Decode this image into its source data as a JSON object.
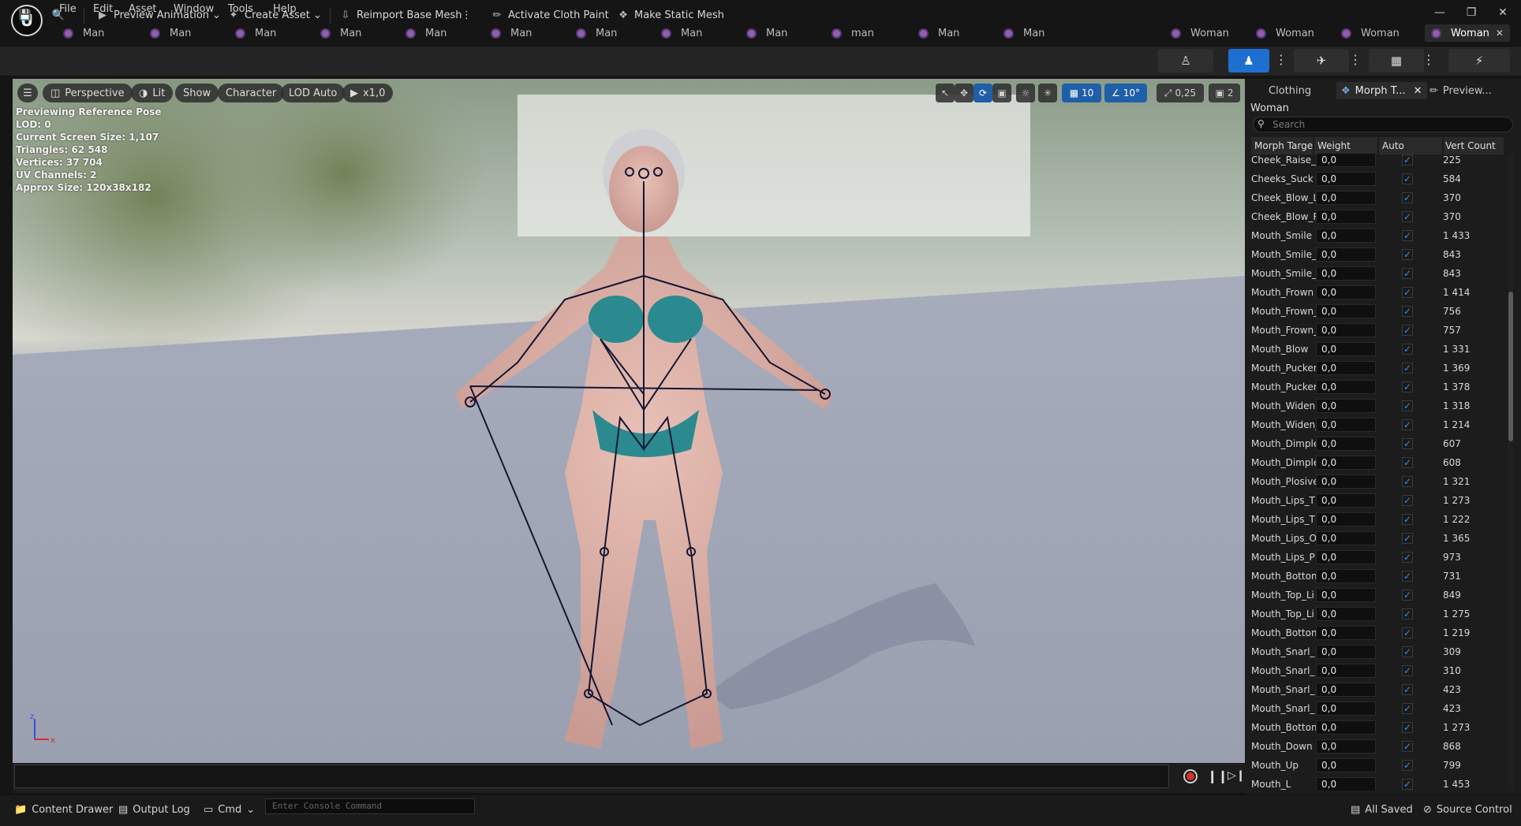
{
  "menu": [
    "File",
    "Edit",
    "Asset",
    "Window",
    "Tools",
    "Help"
  ],
  "tabs": [
    {
      "label": "Man"
    },
    {
      "label": "Man"
    },
    {
      "label": "Man"
    },
    {
      "label": "Man"
    },
    {
      "label": "Man"
    },
    {
      "label": "Man"
    },
    {
      "label": "Man"
    },
    {
      "label": "Man"
    },
    {
      "label": "Man"
    },
    {
      "label": "man"
    },
    {
      "label": "Man"
    },
    {
      "label": "Man"
    },
    {
      "label": "Woman"
    },
    {
      "label": "Woman"
    },
    {
      "label": "Woman"
    },
    {
      "label": "Woman",
      "active": true
    }
  ],
  "toolbar": {
    "preview_animation": "Preview Animation",
    "create_asset": "Create Asset",
    "reimport": "Reimport Base Mesh",
    "activate_cloth": "Activate Cloth Paint",
    "make_static": "Make Static Mesh"
  },
  "viewport": {
    "perspective": "Perspective",
    "lit": "Lit",
    "show": "Show",
    "character": "Character",
    "lod": "LOD Auto",
    "speed": "x1,0",
    "grid": "10",
    "angle": "10°",
    "scale": "0,25",
    "camera": "2",
    "info": [
      "Previewing Reference Pose",
      "LOD: 0",
      "Current Screen Size: 1,107",
      "Triangles: 62 548",
      "Vertices: 37 704",
      "UV Channels: 2",
      "Approx Size: 120x38x182"
    ]
  },
  "panel": {
    "tabs": [
      "Clothing",
      "Morph T...",
      "Preview..."
    ],
    "title": "Woman",
    "search_placeholder": "Search",
    "columns": [
      "Morph Targe",
      "Weight",
      "Auto",
      "Vert Count"
    ],
    "rows": [
      {
        "name": "Cheek_Raise_",
        "weight": "0,0",
        "verts": "225"
      },
      {
        "name": "Cheeks_Suck",
        "weight": "0,0",
        "verts": "584"
      },
      {
        "name": "Cheek_Blow_L",
        "weight": "0,0",
        "verts": "370"
      },
      {
        "name": "Cheek_Blow_R",
        "weight": "0,0",
        "verts": "370"
      },
      {
        "name": "Mouth_Smile",
        "weight": "0,0",
        "verts": "1 433"
      },
      {
        "name": "Mouth_Smile_",
        "weight": "0,0",
        "verts": "843"
      },
      {
        "name": "Mouth_Smile_",
        "weight": "0,0",
        "verts": "843"
      },
      {
        "name": "Mouth_Frown",
        "weight": "0,0",
        "verts": "1 414"
      },
      {
        "name": "Mouth_Frown_",
        "weight": "0,0",
        "verts": "756"
      },
      {
        "name": "Mouth_Frown_",
        "weight": "0,0",
        "verts": "757"
      },
      {
        "name": "Mouth_Blow",
        "weight": "0,0",
        "verts": "1 331"
      },
      {
        "name": "Mouth_Pucker",
        "weight": "0,0",
        "verts": "1 369"
      },
      {
        "name": "Mouth_Pucker",
        "weight": "0,0",
        "verts": "1 378"
      },
      {
        "name": "Mouth_Widen",
        "weight": "0,0",
        "verts": "1 318"
      },
      {
        "name": "Mouth_Widen_",
        "weight": "0,0",
        "verts": "1 214"
      },
      {
        "name": "Mouth_Dimple",
        "weight": "0,0",
        "verts": "607"
      },
      {
        "name": "Mouth_Dimple",
        "weight": "0,0",
        "verts": "608"
      },
      {
        "name": "Mouth_Plosive",
        "weight": "0,0",
        "verts": "1 321"
      },
      {
        "name": "Mouth_Lips_T",
        "weight": "0,0",
        "verts": "1 273"
      },
      {
        "name": "Mouth_Lips_T",
        "weight": "0,0",
        "verts": "1 222"
      },
      {
        "name": "Mouth_Lips_O",
        "weight": "0,0",
        "verts": "1 365"
      },
      {
        "name": "Mouth_Lips_P",
        "weight": "0,0",
        "verts": "973"
      },
      {
        "name": "Mouth_Bottom",
        "weight": "0,0",
        "verts": "731"
      },
      {
        "name": "Mouth_Top_Li",
        "weight": "0,0",
        "verts": "849"
      },
      {
        "name": "Mouth_Top_Li",
        "weight": "0,0",
        "verts": "1 275"
      },
      {
        "name": "Mouth_Bottom",
        "weight": "0,0",
        "verts": "1 219"
      },
      {
        "name": "Mouth_Snarl_",
        "weight": "0,0",
        "verts": "309"
      },
      {
        "name": "Mouth_Snarl_",
        "weight": "0,0",
        "verts": "310"
      },
      {
        "name": "Mouth_Snarl_",
        "weight": "0,0",
        "verts": "423"
      },
      {
        "name": "Mouth_Snarl_",
        "weight": "0,0",
        "verts": "423"
      },
      {
        "name": "Mouth_Bottom",
        "weight": "0,0",
        "verts": "1 273"
      },
      {
        "name": "Mouth_Down",
        "weight": "0,0",
        "verts": "868"
      },
      {
        "name": "Mouth_Up",
        "weight": "0,0",
        "verts": "799"
      },
      {
        "name": "Mouth_L",
        "weight": "0,0",
        "verts": "1 453"
      }
    ]
  },
  "status": {
    "content_drawer": "Content Drawer",
    "output_log": "Output Log",
    "cmd": "Cmd",
    "console_placeholder": "Enter Console Command",
    "all_saved": "All Saved",
    "source_control": "Source Control"
  },
  "colors": {
    "accent": "#1f6fd1",
    "checkbox": "#2d8ef0",
    "asset_icon": "#8f5fb0"
  }
}
